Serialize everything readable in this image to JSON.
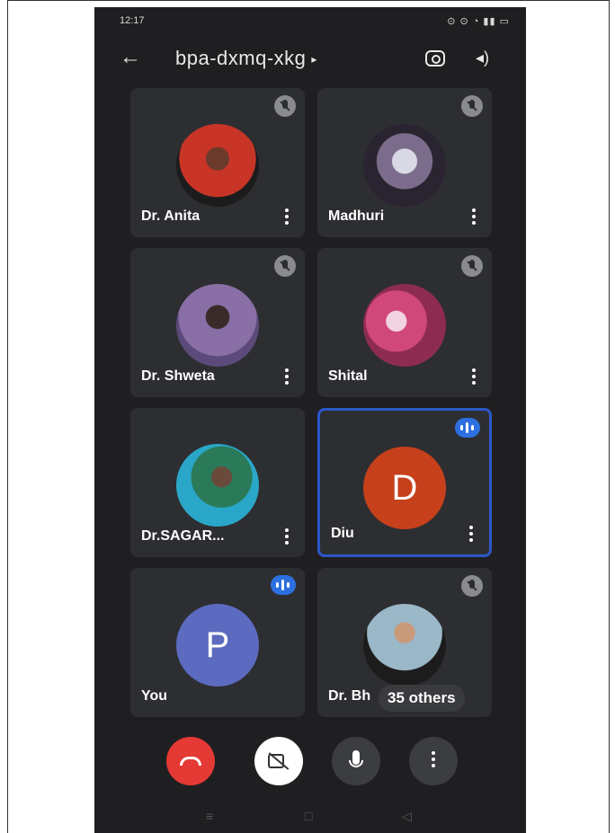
{
  "status_bar": {
    "time": "12:17",
    "icons": "⊙ ⊙ ◔ ▮▮ ▭"
  },
  "header": {
    "back_icon": "back-arrow-icon",
    "meeting_code": "bpa-dxmq-xkg",
    "caret": "▸",
    "camera_switch_icon": "camera-flip-icon",
    "audio_icon": "speaker-icon"
  },
  "tiles": [
    {
      "name": "Dr. Anita",
      "mic": "muted",
      "avatar": "photo"
    },
    {
      "name": "Madhuri",
      "mic": "muted",
      "avatar": "photo"
    },
    {
      "name": "Dr. Shweta",
      "mic": "muted",
      "avatar": "photo"
    },
    {
      "name": "Shital",
      "mic": "muted",
      "avatar": "photo"
    },
    {
      "name": "Dr.SAGAR...",
      "mic": "muted",
      "avatar": "photo"
    },
    {
      "name": "Diu",
      "mic": "speaking",
      "avatar": "letter",
      "letter": "D",
      "avatar_color": "#c6401b",
      "active": true
    },
    {
      "name": "You",
      "mic": "speaking",
      "avatar": "letter",
      "letter": "P",
      "avatar_color": "#5c6bc0"
    },
    {
      "name": "Dr. Bh",
      "mic": "muted",
      "avatar": "photo"
    }
  ],
  "others_chip": "35 others",
  "controls": {
    "end_call_icon": "end-call-icon",
    "camera_off_icon": "camera-off-icon",
    "mic_icon": "mic-icon",
    "more_icon": "more-vertical-icon"
  },
  "nav": {
    "recents": "≡",
    "home": "□",
    "back": "◁"
  },
  "colors": {
    "background": "#1f1f21",
    "tile": "#2d2e31",
    "end_call": "#e53935",
    "active_border": "#2b57c8",
    "speaking_badge": "#2c6fe0"
  }
}
